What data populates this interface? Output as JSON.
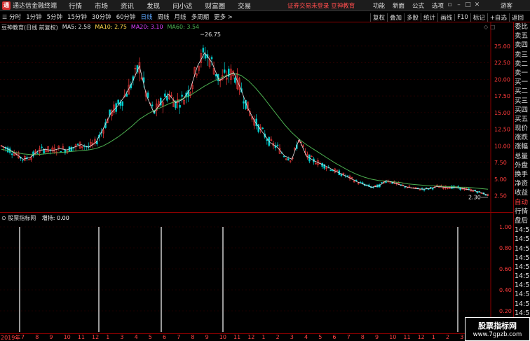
{
  "titlebar": {
    "logo_glyph": "通",
    "app_title": "通达信金融终端",
    "menu": [
      "行情",
      "市场",
      "资讯",
      "发现",
      "问小达",
      "财富圈",
      "交易"
    ],
    "notice": "证券交易未登录  豆神教育",
    "right_menu": [
      "功能",
      "新面",
      "公式",
      "选项"
    ],
    "window_controls": [
      "▫",
      "–",
      "□",
      "✕"
    ],
    "guest": "游客"
  },
  "toolbar": {
    "periods": [
      "分时",
      "1分钟",
      "5分钟",
      "15分钟",
      "30分钟",
      "60分钟",
      "日线",
      "周线",
      "月线",
      "多周期",
      "更多 >"
    ],
    "active_period": "日线",
    "tools": [
      "复权",
      "叠加",
      "多股",
      "统计",
      "画线",
      "F10",
      "标记",
      "+自选",
      "返回"
    ]
  },
  "main_chart": {
    "stock": "豆神教育(日线 前复权)",
    "ma5": "MA5: 2.58",
    "ma10": "MA10: 2.75",
    "ma20": "MA20: 3.10",
    "ma60": "MA60: 3.54",
    "high_label": "26.75",
    "low_label": "2.30",
    "price_ticks": [
      "25.00",
      "22.50",
      "20.00",
      "17.50",
      "15.00",
      "12.50",
      "10.00",
      "7.50",
      "5.00",
      "2.50"
    ],
    "colors": {
      "ma5": "#e0e0e0",
      "ma10": "#ffd54a",
      "ma20": "#e040fb",
      "ma60": "#4caf50",
      "up": "#ff3b3b",
      "down": "#00d0d0"
    }
  },
  "chart_data": {
    "type": "line",
    "ylim": [
      1.0,
      27.5
    ],
    "series": [
      {
        "name": "MA5",
        "values": [
          10.0,
          9.5,
          8.8,
          8.0,
          8.3,
          9.2,
          9.5,
          9.3,
          9.6,
          9.4,
          9.8,
          10.2,
          9.8,
          10.5,
          12.5,
          14.8,
          16.0,
          17.5,
          19.5,
          22.0,
          17.5,
          15.0,
          16.5,
          17.8,
          16.5,
          17.0,
          18.5,
          22.0,
          24.0,
          22.5,
          19.8,
          20.5,
          21.0,
          18.5,
          15.5,
          13.5,
          12.0,
          10.5,
          9.8,
          8.5,
          8.0,
          11.0,
          8.5,
          7.8,
          7.3,
          6.8,
          6.2,
          5.7,
          5.2,
          4.6,
          4.2,
          3.8,
          4.0,
          4.8,
          4.5,
          4.1,
          3.8,
          3.6,
          3.5,
          3.6,
          3.9,
          3.8,
          3.8,
          3.7,
          3.5,
          3.3,
          3.0,
          2.6
        ]
      },
      {
        "name": "MA60",
        "values": [
          9.5,
          9.3,
          9.0,
          8.8,
          8.7,
          8.7,
          8.8,
          8.9,
          9.0,
          9.1,
          9.2,
          9.3,
          9.4,
          9.6,
          10.0,
          10.6,
          11.3,
          12.1,
          13.0,
          14.0,
          14.7,
          15.3,
          15.8,
          16.3,
          16.7,
          17.1,
          17.6,
          18.3,
          19.0,
          19.6,
          20.1,
          20.6,
          20.9,
          20.6,
          19.8,
          18.7,
          17.4,
          16.0,
          14.6,
          13.2,
          12.0,
          11.0,
          10.2,
          9.5,
          8.8,
          8.1,
          7.4,
          6.8,
          6.2,
          5.7,
          5.3,
          5.0,
          4.8,
          4.7,
          4.6,
          4.5,
          4.3,
          4.2,
          4.1,
          4.0,
          4.0,
          3.9,
          3.9,
          3.8,
          3.8,
          3.7,
          3.6,
          3.5
        ]
      }
    ]
  },
  "sub_chart": {
    "title": "股票指标网",
    "hold_label": "增持: 0.00",
    "axis_ticks": [
      "1.00",
      "0.80",
      "0.60",
      "0.40",
      "0.20"
    ],
    "spikes_at": [
      28,
      141,
      230,
      318,
      653
    ]
  },
  "date_axis": [
    "2019年",
    "7",
    "8",
    "9",
    "10",
    "11",
    "12",
    "1",
    "3",
    "4",
    "5",
    "6",
    "7",
    "8",
    "9",
    "10",
    "11",
    "12",
    "1",
    "2",
    "3",
    "4",
    "5",
    "6",
    "7",
    "8",
    "9",
    "10",
    "11",
    "12",
    "1",
    "2",
    "3"
  ],
  "sidebar": [
    {
      "t": "委比",
      "c": "normal"
    },
    {
      "t": "卖五",
      "c": "normal"
    },
    {
      "t": "卖四",
      "c": "normal"
    },
    {
      "t": "卖三",
      "c": "normal"
    },
    {
      "t": "卖二",
      "c": "normal"
    },
    {
      "t": "卖一",
      "c": "normal"
    },
    {
      "t": "买一",
      "c": "normal"
    },
    {
      "t": "买二",
      "c": "normal"
    },
    {
      "t": "买三",
      "c": "normal"
    },
    {
      "t": "买四",
      "c": "normal"
    },
    {
      "t": "买五",
      "c": "normal"
    },
    {
      "t": "现价",
      "c": "normal"
    },
    {
      "t": "涨跌",
      "c": "normal"
    },
    {
      "t": "涨幅",
      "c": "normal"
    },
    {
      "t": "总量",
      "c": "normal"
    },
    {
      "t": "外盘",
      "c": "normal"
    },
    {
      "t": "换手",
      "c": "normal"
    },
    {
      "t": "净资",
      "c": "normal"
    },
    {
      "t": "收益",
      "c": "normal"
    },
    {
      "t": "自动",
      "c": "red"
    },
    {
      "t": "行情",
      "c": "normal"
    },
    {
      "t": "盘后",
      "c": "normal"
    },
    {
      "t": "14:50",
      "c": "normal"
    },
    {
      "t": "14:50",
      "c": "normal"
    },
    {
      "t": "14:50",
      "c": "normal"
    },
    {
      "t": "14:50",
      "c": "normal"
    },
    {
      "t": "14:50",
      "c": "normal"
    },
    {
      "t": "14:50",
      "c": "normal"
    },
    {
      "t": "14:50",
      "c": "normal"
    },
    {
      "t": "14:50",
      "c": "normal"
    },
    {
      "t": "14:50",
      "c": "normal"
    },
    {
      "t": "14:5",
      "c": "normal"
    }
  ],
  "watermark": {
    "line1": "股票指标网",
    "line2": "www.7gpzb.com"
  }
}
